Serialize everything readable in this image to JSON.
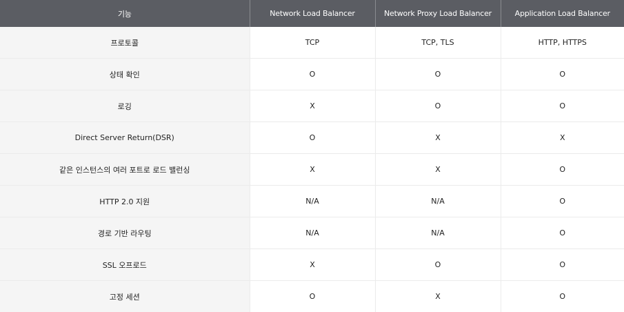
{
  "table": {
    "headers": [
      "기능",
      "Network Load Balancer",
      "Network Proxy Load Balancer",
      "Application Load Balancer"
    ],
    "rows": [
      [
        "프로토콜",
        "TCP",
        "TCP, TLS",
        "HTTP, HTTPS"
      ],
      [
        "상태 확인",
        "O",
        "O",
        "O"
      ],
      [
        "로깅",
        "X",
        "O",
        "O"
      ],
      [
        "Direct Server Return(DSR)",
        "O",
        "X",
        "X"
      ],
      [
        "같은 인스턴스의 여러 포트로 로드 밸런싱",
        "X",
        "X",
        "O"
      ],
      [
        "HTTP 2.0 지원",
        "N/A",
        "N/A",
        "O"
      ],
      [
        "경로 기반 라우팅",
        "N/A",
        "N/A",
        "O"
      ],
      [
        "SSL 오프로드",
        "X",
        "O",
        "O"
      ],
      [
        "고정 세션",
        "O",
        "X",
        "O"
      ]
    ]
  },
  "colors": {
    "header_bg": "#5b5d63",
    "feature_col_bg": "#f5f5f5",
    "border": "#ebebeb"
  }
}
